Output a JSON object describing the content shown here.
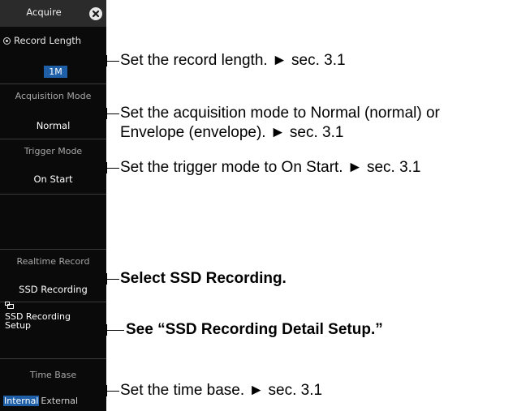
{
  "menu": {
    "title": "Acquire",
    "record_length": {
      "label": "Record Length",
      "value": "1M"
    },
    "acquisition_mode": {
      "label": "Acquisition Mode",
      "value": "Normal"
    },
    "trigger_mode": {
      "label": "Trigger Mode",
      "value": "On Start"
    },
    "realtime_record": {
      "label": "Realtime Record",
      "value": "SSD Recording"
    },
    "ssd_setup": {
      "line1": "SSD Recording",
      "line2": "Setup"
    },
    "time_base": {
      "label": "Time Base",
      "selected": "Internal",
      "other": "External"
    }
  },
  "callouts": {
    "record_length": "Set the record length. ► sec. 3.1",
    "acq_line1": "Set the acquisition mode to Normal (normal) or",
    "acq_line2": "Envelope (envelope). ► sec. 3.1",
    "trigger": "Set the trigger mode to On Start. ► sec. 3.1",
    "ssd": "Select SSD Recording.",
    "detail": "See “SSD Recording Detail Setup.”",
    "time_base": "Set the time base. ► sec. 3.1"
  },
  "colors": {
    "panel_bg": "#0a0a0a",
    "accent": "#1e5fa8",
    "label_gray": "#a7a7a7"
  },
  "icons": {
    "close": "close-icon",
    "radio": "radio-selected-icon",
    "setup": "setup-icon"
  }
}
